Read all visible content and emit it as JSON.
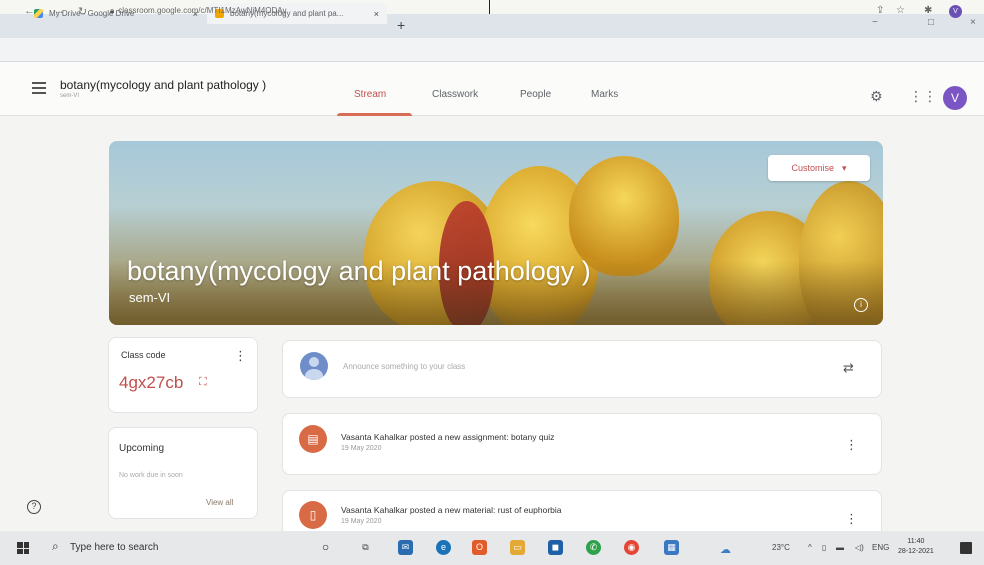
{
  "browser": {
    "tabs": [
      {
        "label": "My Drive - Google Drive",
        "close": "×"
      },
      {
        "label": "botany(mycology and plant pa...",
        "close": "×"
      }
    ],
    "new_tab": "+",
    "window_controls": {
      "minimize": "−",
      "maximize": "□",
      "close": "×"
    },
    "url": "classroom.google.com/c/MTI1MzAwNjM4ODAy",
    "profile_initial": "V"
  },
  "classroom": {
    "class_title": "botany(mycology and plant pathology )",
    "class_section": "sem-VI",
    "tabs": [
      {
        "label": "Stream",
        "active": true
      },
      {
        "label": "Classwork",
        "active": false
      },
      {
        "label": "People",
        "active": false
      },
      {
        "label": "Marks",
        "active": false
      }
    ],
    "profile_initial": "V",
    "banner": {
      "title": "botany(mycology and plant pathology )",
      "subtitle": "sem-VI",
      "customise_label": "Customise",
      "info_glyph": "i"
    },
    "class_code": {
      "label": "Class code",
      "code": "4gx27cb"
    },
    "upcoming": {
      "label": "Upcoming",
      "text": "No work due in soon",
      "view_all": "View all"
    },
    "announce_placeholder": "Announce something to your class",
    "posts": [
      {
        "text": "Vasanta Kahalkar posted a new assignment: botany quiz",
        "date": "19 May 2020",
        "icon": "assignment-icon"
      },
      {
        "text": "Vasanta Kahalkar posted a new material: rust of euphorbia",
        "date": "19 May 2020",
        "icon": "material-icon"
      }
    ]
  },
  "taskbar": {
    "search_placeholder": "Type here to search",
    "temperature": "23°C",
    "language": "ENG",
    "time": "11:40",
    "date": "28-12-2021"
  },
  "colors": {
    "accent": "#c0504d",
    "stream_underline": "#d86c55",
    "avatar_purple": "#7b55c4"
  }
}
